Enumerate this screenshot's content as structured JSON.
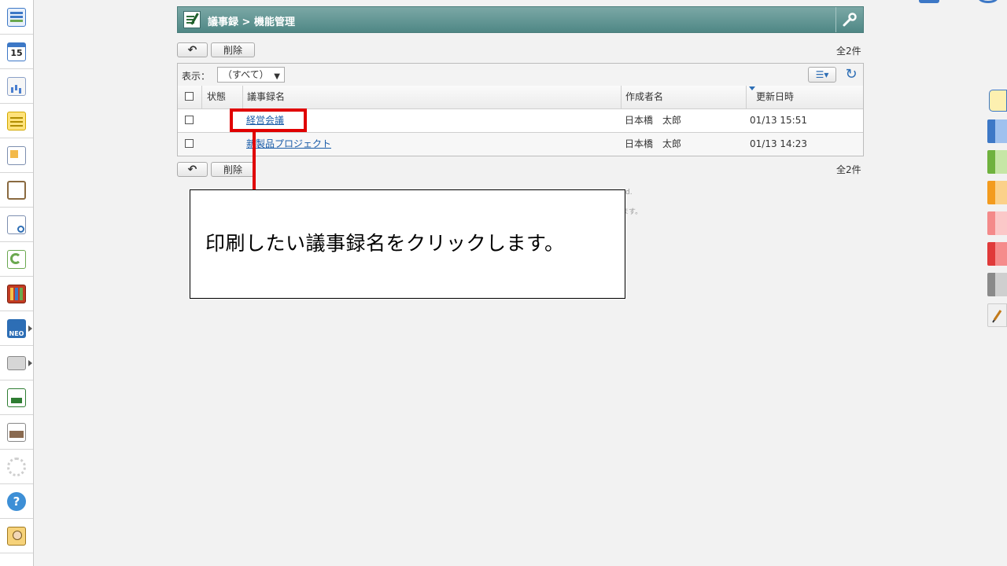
{
  "header": {
    "title": "議事録 > 機能管理"
  },
  "toolbar": {
    "back_label": "↶",
    "delete_label": "削除",
    "count": "全2件"
  },
  "filter": {
    "label": "表示：",
    "selected": "（すべて）"
  },
  "table": {
    "columns": [
      "状態",
      "議事録名",
      "作成者名",
      "更新日時"
    ],
    "rows": [
      {
        "status": "",
        "name": "経営会議",
        "author": "日本橋　太郎",
        "updated": "01/13 15:51"
      },
      {
        "status": "",
        "name": "新製品プロジェクト",
        "author": "日本橋　太郎",
        "updated": "01/13 14:23"
      }
    ]
  },
  "background_faint": {
    "line1": "d.",
    "line2": "ます。"
  },
  "callout": {
    "text": "印刷したい議事録名をクリックします。"
  },
  "left_bar": {
    "calendar_day": "15",
    "neo_label": "NEO",
    "help_glyph": "?"
  },
  "colors": {
    "title_bar": "#5b9391",
    "accent_link": "#1a5ca8",
    "annotation_red": "#e00000"
  }
}
